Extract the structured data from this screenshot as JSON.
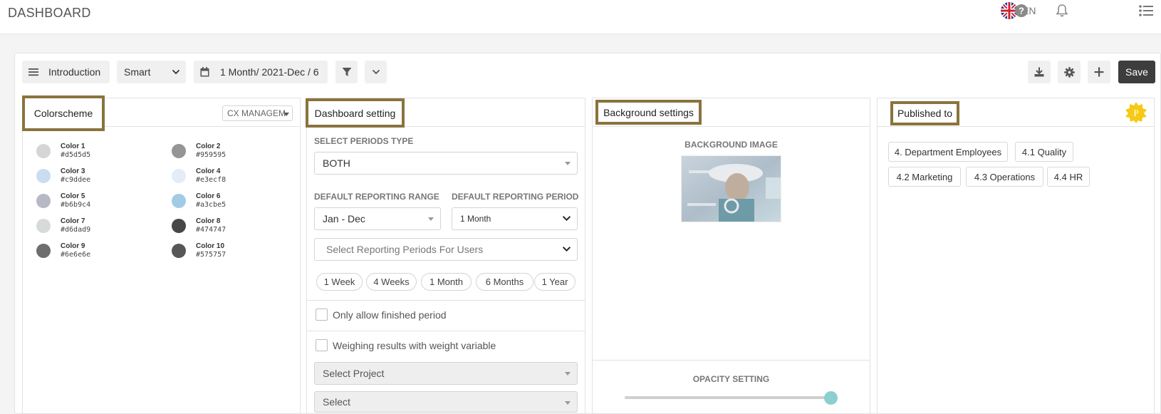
{
  "header": {
    "title": "DASHBOARD",
    "language": "EN"
  },
  "toolbar": {
    "menu_label": "Introduction",
    "mode_value": "Smart",
    "period_label": "1 Month/ 2021-Dec / 6",
    "save_label": "Save"
  },
  "colorscheme": {
    "title": "Colorscheme",
    "selector": "CX MANAGEM",
    "colors": [
      {
        "name": "Color 1",
        "hex": "#d5d5d5"
      },
      {
        "name": "Color 2",
        "hex": "#959595"
      },
      {
        "name": "Color 3",
        "hex": "#c9ddee"
      },
      {
        "name": "Color 4",
        "hex": "#e3ecf8"
      },
      {
        "name": "Color 5",
        "hex": "#b6b9c4"
      },
      {
        "name": "Color 6",
        "hex": "#a3cbe5"
      },
      {
        "name": "Color 7",
        "hex": "#d6dad9"
      },
      {
        "name": "Color 8",
        "hex": "#474747"
      },
      {
        "name": "Color 9",
        "hex": "#6e6e6e"
      },
      {
        "name": "Color 10",
        "hex": "#575757"
      }
    ]
  },
  "dashboard_setting": {
    "title": "Dashboard setting",
    "periods_type_label": "SELECT PERIODS TYPE",
    "periods_type_value": "BOTH",
    "range_label": "DEFAULT REPORTING RANGE",
    "range_value": "Jan - Dec",
    "period_label": "DEFAULT REPORTING PERIOD",
    "period_value": "1 Month",
    "user_periods_placeholder": "Select Reporting Periods For Users",
    "period_pills": [
      "1 Week",
      "4 Weeks",
      "1 Month",
      "6 Months",
      "1 Year"
    ],
    "finished_period_label": "Only allow finished period",
    "weighing_label": "Weighing results with weight variable",
    "project_placeholder": "Select Project",
    "select_placeholder": "Select"
  },
  "background": {
    "title": "Background settings",
    "image_label": "BACKGROUND IMAGE",
    "opacity_label": "OPACITY SETTING",
    "opacity_value": 1.0
  },
  "published": {
    "title": "Published to",
    "badge": "P",
    "tags": [
      "4. Department Employees",
      "4.1 Quality",
      "4.2 Marketing",
      "4.3 Operations",
      "4.4 HR"
    ]
  },
  "colors": {
    "accent_border": "#8a733d",
    "slider_knob": "#8ccfcf",
    "save_bg": "#3d3d3d",
    "badge": "#f6c915"
  }
}
